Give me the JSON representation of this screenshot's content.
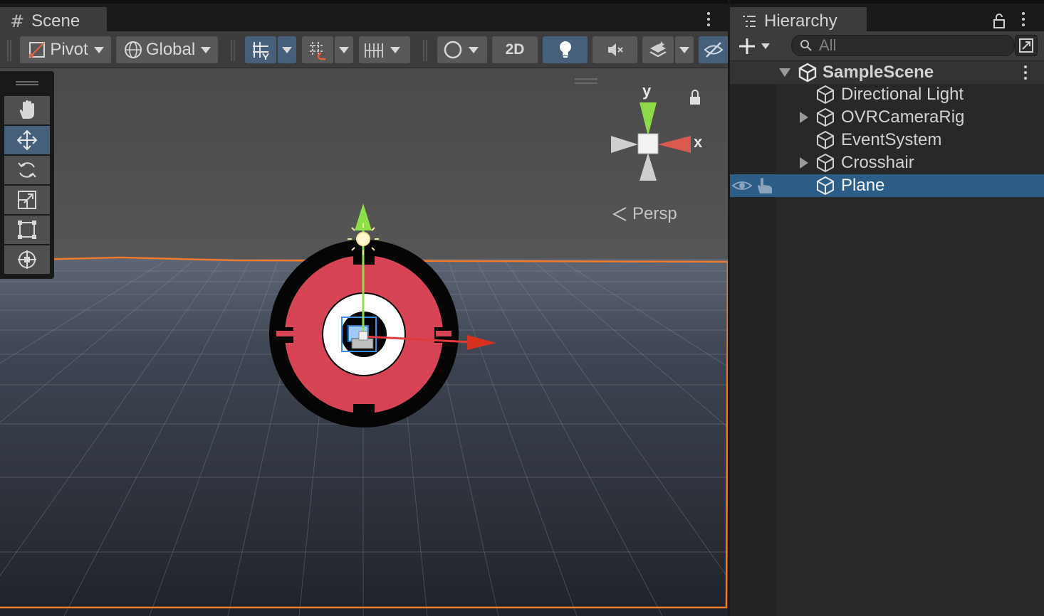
{
  "scene": {
    "tab_title": "Scene",
    "toolbar": {
      "pivot_label": "Pivot",
      "global_label": "Global",
      "mode_2d_label": "2D"
    },
    "view_label": "Persp",
    "gizmo": {
      "y_label": "y",
      "x_label": "x"
    },
    "tools": [
      "hand",
      "move",
      "rotate",
      "scale",
      "rect",
      "transform"
    ],
    "active_tool": "move"
  },
  "hierarchy": {
    "tab_title": "Hierarchy",
    "search_placeholder": "All",
    "scene_name": "SampleScene",
    "items": [
      {
        "label": "Directional Light",
        "expandable": false
      },
      {
        "label": "OVRCameraRig",
        "expandable": true
      },
      {
        "label": "EventSystem",
        "expandable": false
      },
      {
        "label": "Crosshair",
        "expandable": true
      },
      {
        "label": "Plane",
        "expandable": false,
        "selected": true
      }
    ]
  },
  "colors": {
    "selection": "#2c5d87",
    "active_button": "#46607c",
    "target_red": "#d64456",
    "plane_outline": "#f07a2c"
  }
}
